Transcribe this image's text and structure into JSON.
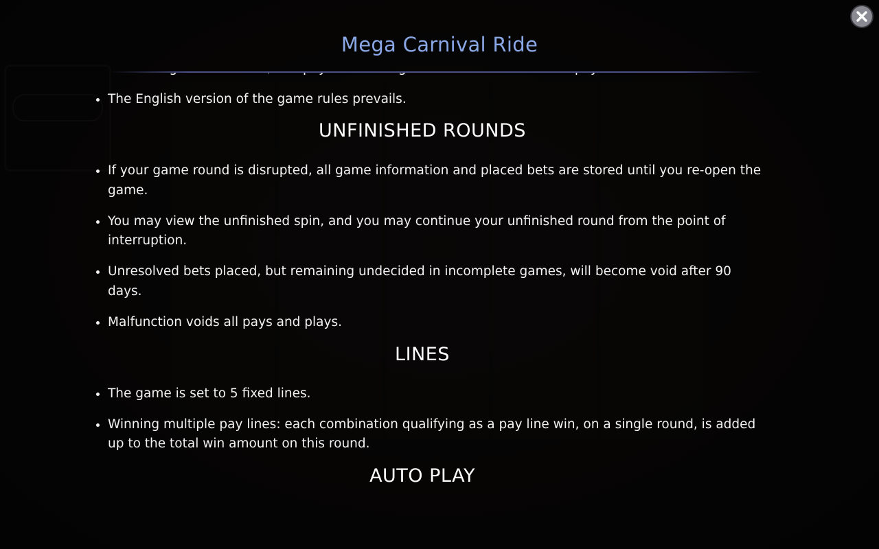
{
  "modal": {
    "title": "Mega Carnival Ride",
    "close_icon": "close-icon",
    "accent_color": "#8aa8e6"
  },
  "rules": {
    "intro_bullets": [
      "All winning combinations, and payouts in the game can be viewed in the paytable.",
      "The English version of the game rules prevails."
    ],
    "unfinished_rounds": {
      "heading": "UNFINISHED ROUNDS",
      "bullets": [
        "If your game round is disrupted, all game information and placed bets are stored until you re-open the game.",
        "You may view the unfinished spin, and you may continue your unfinished round from the point of interruption.",
        "Unresolved bets placed, but remaining undecided in incomplete games, will become void after 90 days.",
        "Malfunction voids all pays and plays."
      ]
    },
    "lines": {
      "heading": "LINES",
      "bullets": [
        "The game is set to 5 fixed lines.",
        "Winning multiple pay lines: each combination qualifying as a pay line win, on a single round, is added up to the total win amount on this round."
      ]
    },
    "auto_play": {
      "heading": "AUTO PLAY"
    }
  }
}
